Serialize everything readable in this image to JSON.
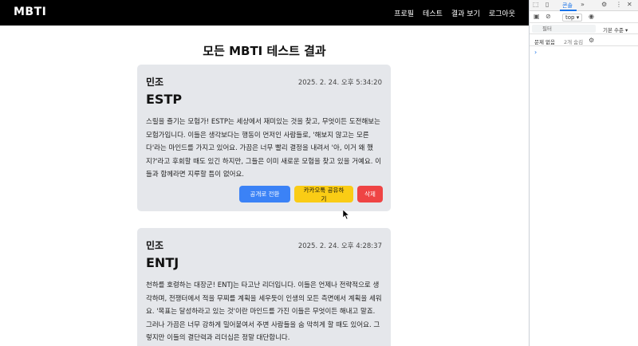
{
  "navbar": {
    "brand": "MBTI",
    "links": [
      "프로필",
      "테스트",
      "결과 보기",
      "로그아웃"
    ]
  },
  "page_title": "모든 MBTI 테스트 결과",
  "cards": [
    {
      "name": "민조",
      "date": "2025. 2. 24. 오후 5:34:20",
      "type": "ESTP",
      "desc": "스릴을 즐기는 모험가! ESTP는 세상에서 재미있는 것을 찾고, 무엇이든 도전해보는 모험가입니다. 이들은 생각보다는 행동이 먼저인 사람들로, '해보지 않고는 모른다'라는 마인드를 가지고 있어요. 가끔은 너무 빨리 결정을 내려서 '아, 이거 왜 했지?'라고 후회할 때도 있긴 하지만, 그들은 이미 새로운 모험을 찾고 있을 거예요. 이들과 함께라면 지루할 틈이 없어요.",
      "buttons": {
        "public": "공개로 전환",
        "kakao": "카카오톡 공유하기",
        "delete": "삭제"
      }
    },
    {
      "name": "민조",
      "date": "2025. 2. 24. 오후 4:28:37",
      "type": "ENTJ",
      "desc": "천하를 호령하는 대장군! ENTJ는 타고난 리더입니다. 이들은 언제나 전략적으로 생각하며, 전쟁터에서 적을 무찌를 계획을 세우듯이 인생의 모든 측면에서 계획을 세워요. '목표는 달성하라고 있는 것'이란 마인드를 가진 이들은 무엇이든 해내고 말죠. 그러나 가끔은 너무 강하게 밀어붙여서 주변 사람들을 숨 막히게 할 때도 있어요. 그렇지만 이들의 결단력과 리더십은 정말 대단합니다."
    }
  ],
  "devtools": {
    "tab_console": "콘솔",
    "tab_more": "»",
    "context": "top ▾",
    "filter_placeholder": "필터",
    "level": "기본 수준 ▾",
    "issues": "문제 없음",
    "hidden": "2개 숨김",
    "prompt": "›"
  },
  "colors": {
    "navbar": "#000000",
    "card": "#e5e7eb",
    "public_button": "#3b82f6",
    "kakao_button": "#facc15",
    "delete_button": "#ef4444",
    "devtools_accent": "#1a73e8"
  }
}
